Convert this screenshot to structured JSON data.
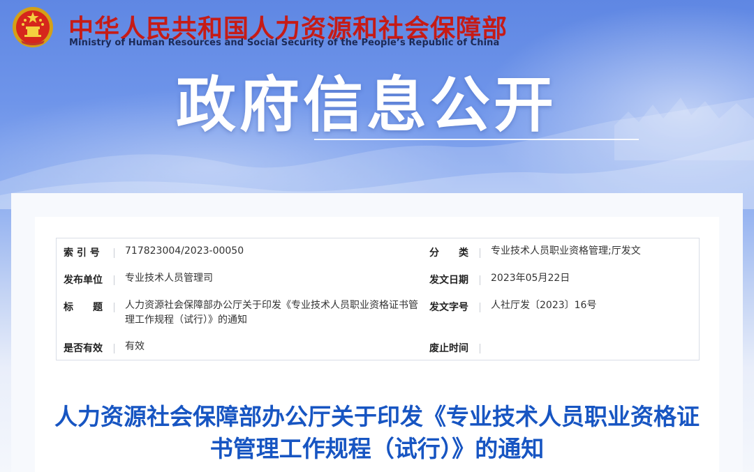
{
  "header": {
    "ministry_cn": "中华人民共和国人力资源和社会保障部",
    "ministry_en": "Ministry of Human Resources and Social Security of the People’s Republic of China",
    "section_title": "政府信息公开"
  },
  "metadata": {
    "index_no": {
      "label": "索 引 号",
      "value": "717823004/2023-00050"
    },
    "category": {
      "label": "分　　类",
      "value": "专业技术人员职业资格管理;厅发文"
    },
    "publisher": {
      "label": "发布单位",
      "value": "专业技术人员管理司"
    },
    "issue_date": {
      "label": "发文日期",
      "value": "2023年05月22日"
    },
    "subject": {
      "label": "标　　题",
      "value": "人力资源社会保障部办公厅关于印发《专业技术人员职业资格证书管理工作规程（试行）》的通知"
    },
    "doc_number": {
      "label": "发文字号",
      "value": "人社厅发〔2023〕16号"
    },
    "validity": {
      "label": "是否有效",
      "value": "有效"
    },
    "repeal_time": {
      "label": "废止时间",
      "value": ""
    }
  },
  "document": {
    "title": "人力资源社会保障部办公厅关于印发《专业技术人员职业资格证书管理工作规程（试行）》的通知"
  },
  "colors": {
    "ministry_red": "#c61b16",
    "title_blue": "#1755c2",
    "banner_blue": "#6f95ea"
  }
}
